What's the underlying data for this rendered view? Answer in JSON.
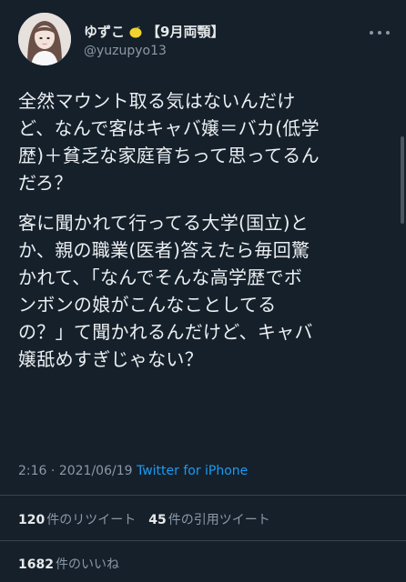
{
  "author": {
    "display_name": "ゆずこ",
    "badge": "【9月両顎】",
    "handle": "@yuzupyo13",
    "avatar_icon": "avatar-illustration"
  },
  "tweet": {
    "paragraph1": "全然マウント取る気はないんだけ\nど、なんで客はキャバ嬢＝バカ(低学\n歴)＋貧乏な家庭育ちって思ってるん\nだろ？",
    "paragraph2": "客に聞かれて行ってる大学(国立)と\nか、親の職業(医者)答えたら毎回驚\nかれて、「なんでそんな高学歴でボ\nンボンの娘がこんなことしてる\nの？」て聞かれるんだけど、キャバ\n嬢舐めすぎじゃない？"
  },
  "meta": {
    "time": "2:16",
    "separator": "·",
    "date": "2021/06/19",
    "source": "Twitter for iPhone"
  },
  "stats": {
    "retweets_count": "120",
    "retweets_label": "件のリツイート",
    "quotes_count": "45",
    "quotes_label": "件の引用ツイート",
    "likes_count": "1682",
    "likes_label": "件のいいね"
  },
  "colors": {
    "background": "#15202b",
    "link": "#1d9bf0",
    "secondary_text": "#8b98a5"
  }
}
